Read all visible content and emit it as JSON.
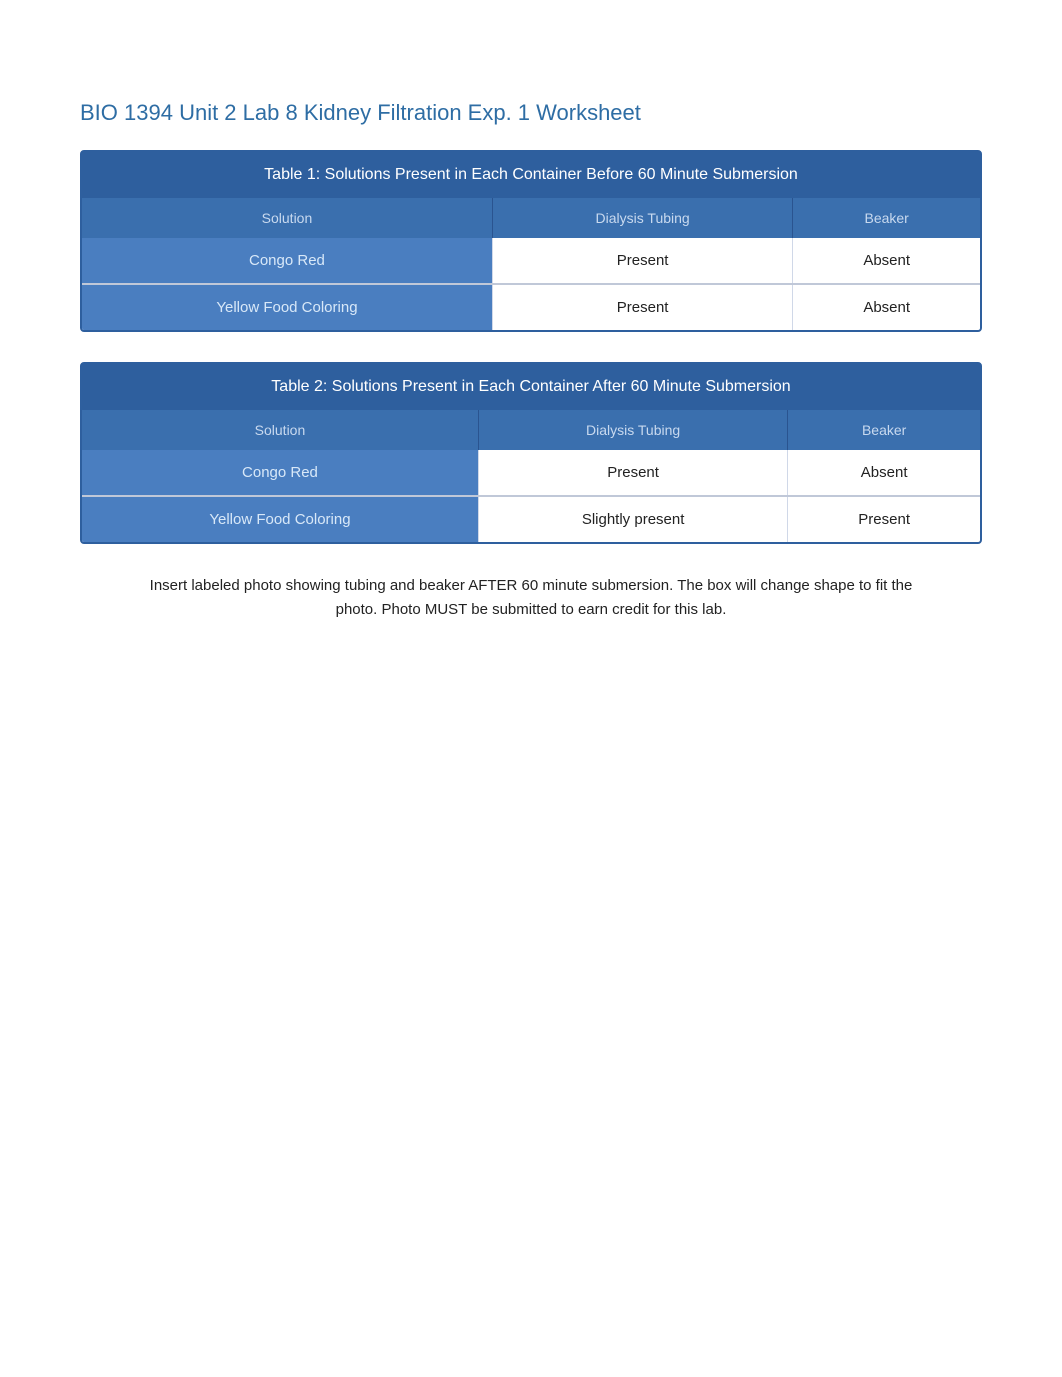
{
  "page": {
    "title": "BIO 1394 Unit 2 Lab 8 Kidney Filtration Exp. 1 Worksheet"
  },
  "table1": {
    "title": "Table 1: Solutions Present in Each Container Before 60 Minute Submersion",
    "columns": [
      "Solution",
      "Dialysis Tubing",
      "Beaker"
    ],
    "rows": [
      {
        "solution": "Congo Red",
        "dialysis_tubing": "Present",
        "beaker": "Absent"
      },
      {
        "solution": "Yellow Food Coloring",
        "dialysis_tubing": "Present",
        "beaker": "Absent"
      }
    ]
  },
  "table2": {
    "title": "Table 2: Solutions Present in Each Container After 60 Minute Submersion",
    "columns": [
      "Solution",
      "Dialysis Tubing",
      "Beaker"
    ],
    "rows": [
      {
        "solution": "Congo Red",
        "dialysis_tubing": "Present",
        "beaker": "Absent"
      },
      {
        "solution": "Yellow Food Coloring",
        "dialysis_tubing": "Slightly present",
        "beaker": "Present"
      }
    ]
  },
  "photo_note": "Insert labeled photo showing tubing and beaker AFTER 60 minute submersion. The box will change shape to fit the photo.      Photo MUST be submitted to earn credit for this lab."
}
